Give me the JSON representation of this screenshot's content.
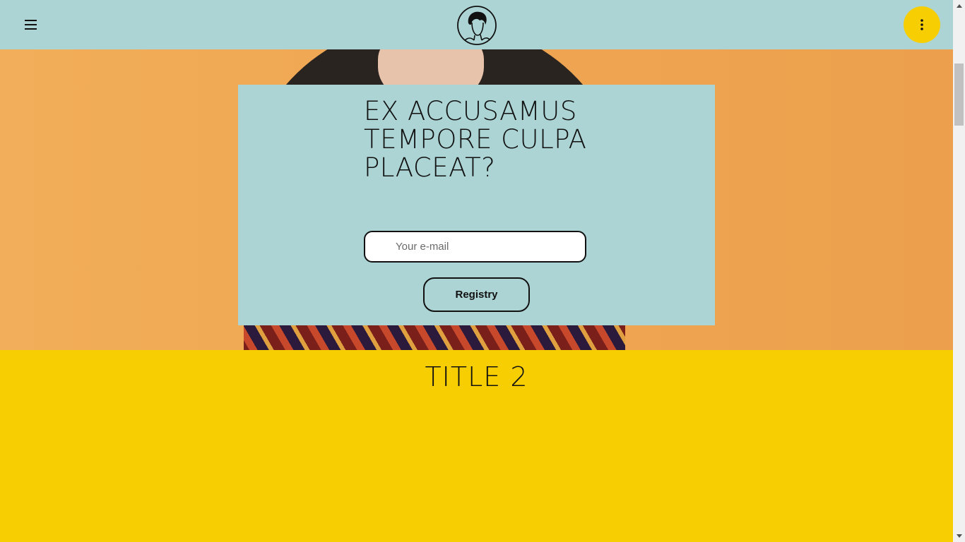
{
  "header": {
    "menu_icon": "hamburger-menu-icon",
    "logo_icon": "avatar-logo-icon",
    "more_icon": "vertical-dots-icon",
    "colors": {
      "background": "#acd4d4",
      "accent": "#f6ce02"
    }
  },
  "hero": {
    "headline": "EX ACCUSAMUS TEMPORE CULPA PLACEAT?",
    "email_placeholder": "Your e-mail",
    "email_value": "",
    "register_label": "Registry",
    "colors": {
      "card": "#acd4d4",
      "background": "#efa652"
    }
  },
  "section2": {
    "title": "TITLE 2",
    "colors": {
      "background": "#f6ce02"
    }
  },
  "scrollbar": {
    "up_icon": "scroll-up-arrow-icon",
    "down_icon": "scroll-down-arrow-icon"
  }
}
